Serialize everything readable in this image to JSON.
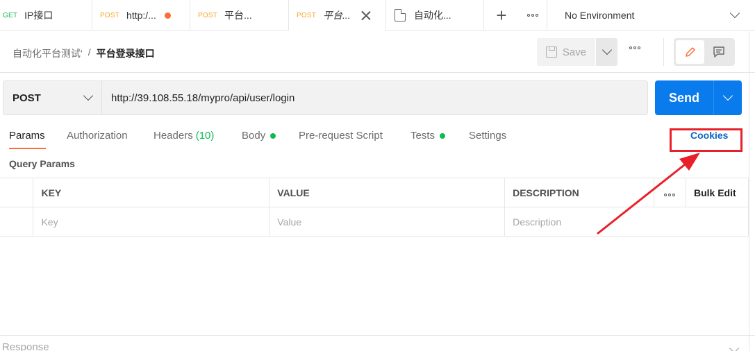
{
  "tabs": [
    {
      "method": "GET",
      "label": "IP接口"
    },
    {
      "method": "POST",
      "label": "http:/..."
    },
    {
      "method": "POST",
      "label": "平台..."
    },
    {
      "method": "POST",
      "label": "平台..."
    },
    {
      "label": "自动化..."
    }
  ],
  "environment": {
    "label": "No Environment"
  },
  "breadcrumb": {
    "parent": "自动化平台测试'",
    "separator": "/",
    "current": "平台登录接口"
  },
  "toolbar": {
    "save_label": "Save"
  },
  "request": {
    "method": "POST",
    "url": "http://39.108.55.18/mypro/api/user/login"
  },
  "send": {
    "label": "Send"
  },
  "subtabs": {
    "params": "Params",
    "authorization": "Authorization",
    "headers": "Headers",
    "headers_count": "(10)",
    "body": "Body",
    "prerequest": "Pre-request Script",
    "tests": "Tests",
    "settings": "Settings",
    "cookies": "Cookies"
  },
  "query_params": {
    "title": "Query Params",
    "columns": {
      "key": "KEY",
      "value": "VALUE",
      "description": "DESCRIPTION",
      "bulk_edit": "Bulk Edit"
    },
    "placeholders": {
      "key": "Key",
      "value": "Value",
      "description": "Description"
    }
  },
  "response": {
    "label": "Response"
  },
  "colors": {
    "accent_orange": "#ff6c37",
    "send_blue": "#097bed",
    "get_green": "#0cbb52",
    "post_orange": "#f5a623",
    "annotation_red": "#e8202a",
    "link_blue": "#0b66c3"
  }
}
